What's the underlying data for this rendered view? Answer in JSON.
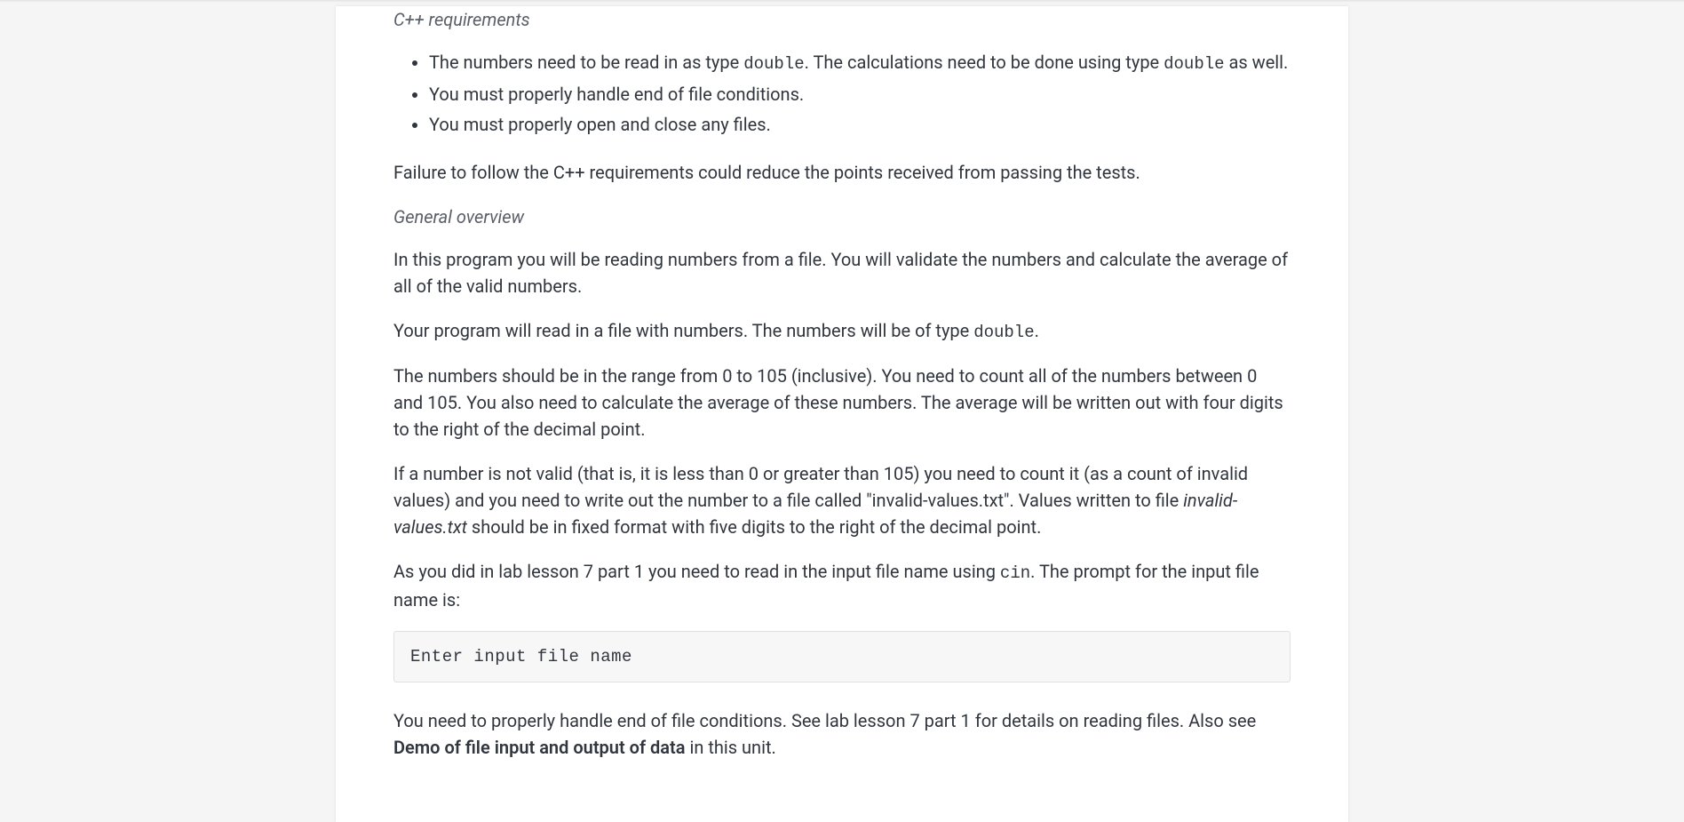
{
  "content": {
    "heading1": "C++ requirements",
    "req_list": {
      "item1_pre": "The numbers need to be read in as type ",
      "item1_code1": "double",
      "item1_mid": ". The calculations need to be done using type ",
      "item1_code2": "double",
      "item1_post": " as well.",
      "item2": "You must properly handle end of file conditions.",
      "item3": "You must properly open and close any files."
    },
    "para1": "Failure to follow the C++ requirements could reduce the points received from passing the tests.",
    "heading2": "General overview",
    "para2": "In this program you will be reading numbers from a file. You will validate the numbers and calculate the average of all of the valid numbers.",
    "para3_pre": "Your program will read in a file with numbers. The numbers will be of type ",
    "para3_code": "double",
    "para3_post": ".",
    "para4": "The numbers should be in the range from 0 to 105 (inclusive). You need to count all of the numbers between 0 and 105. You also need to calculate the average of these numbers. The average will be written out with four digits to the right of the decimal point.",
    "para5_pre": "If a number is not valid (that is, it is less than 0 or greater than 105) you need to count it (as a count of invalid values) and you need to write out the number to a file called \"invalid-values.txt\". Values written to file ",
    "para5_italic": "invalid-values.txt",
    "para5_post": " should be in fixed format with five digits to the right of the decimal point.",
    "para6_pre": "As you did in lab lesson 7 part 1 you need to read in the input file name using ",
    "para6_code": "cin",
    "para6_post": ". The prompt for the input file name is:",
    "code_block": "Enter input file name",
    "para7_pre": "You need to properly handle end of file conditions. See lab lesson 7 part 1 for details on reading files. Also see ",
    "para7_bold": "Demo of file input and output of data",
    "para7_post": " in this unit."
  }
}
